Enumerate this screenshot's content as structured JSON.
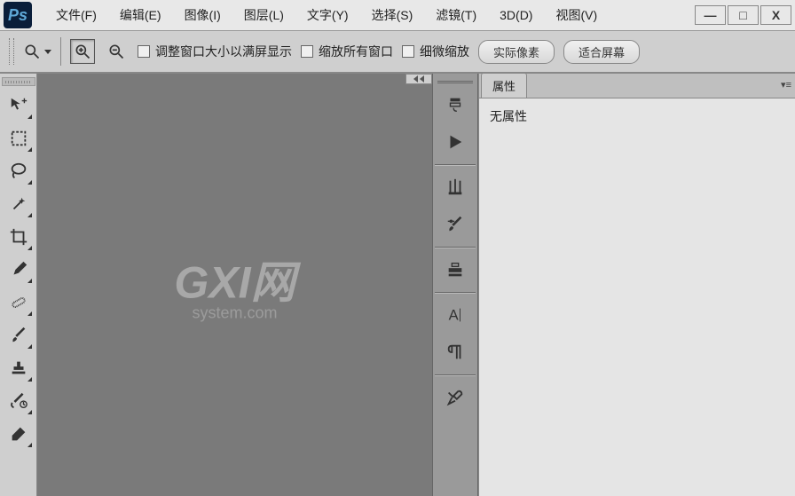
{
  "logo_text": "Ps",
  "menubar": {
    "file": "文件(F)",
    "edit": "编辑(E)",
    "image": "图像(I)",
    "layer": "图层(L)",
    "type": "文字(Y)",
    "select": "选择(S)",
    "filter": "滤镜(T)",
    "3d": "3D(D)",
    "view": "视图(V)"
  },
  "window_controls": {
    "min": "—",
    "max": "□",
    "close": "X"
  },
  "options": {
    "resize_to_fit": "调整窗口大小以满屏显示",
    "zoom_all": "缩放所有窗口",
    "scrubby_zoom": "细微缩放",
    "actual_pixels": "实际像素",
    "fit_screen": "适合屏幕"
  },
  "properties_panel": {
    "tab_label": "属性",
    "empty_text": "无属性"
  },
  "watermark": {
    "main": "GXI网",
    "sub": "system.com"
  }
}
